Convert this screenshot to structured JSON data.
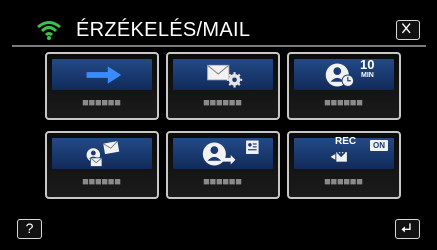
{
  "header": {
    "title": "ÉRZÉKELÉS/MAIL",
    "status_icon": "wifi-icon",
    "close_icon": "close-icon",
    "accent_color": "#3cc24a"
  },
  "tiles": [
    {
      "icon": "arrow-right-icon",
      "label": "■■■■■■"
    },
    {
      "icon": "mail-settings-icon",
      "label": "■■■■■■"
    },
    {
      "icon": "timer-10-min-icon",
      "badge_value": "10",
      "badge_unit": "MIN",
      "label": "■■■■■■"
    },
    {
      "icon": "mail-recipient-icon",
      "label": "■■■■■■"
    },
    {
      "icon": "address-book-icon",
      "label": "■■■■■■"
    },
    {
      "icon": "rec-on-icon",
      "rec_text": "REC",
      "switch_text": "ON",
      "label": "■■■■■■"
    }
  ],
  "footer": {
    "help_label": "?",
    "back_icon": "back-icon"
  }
}
